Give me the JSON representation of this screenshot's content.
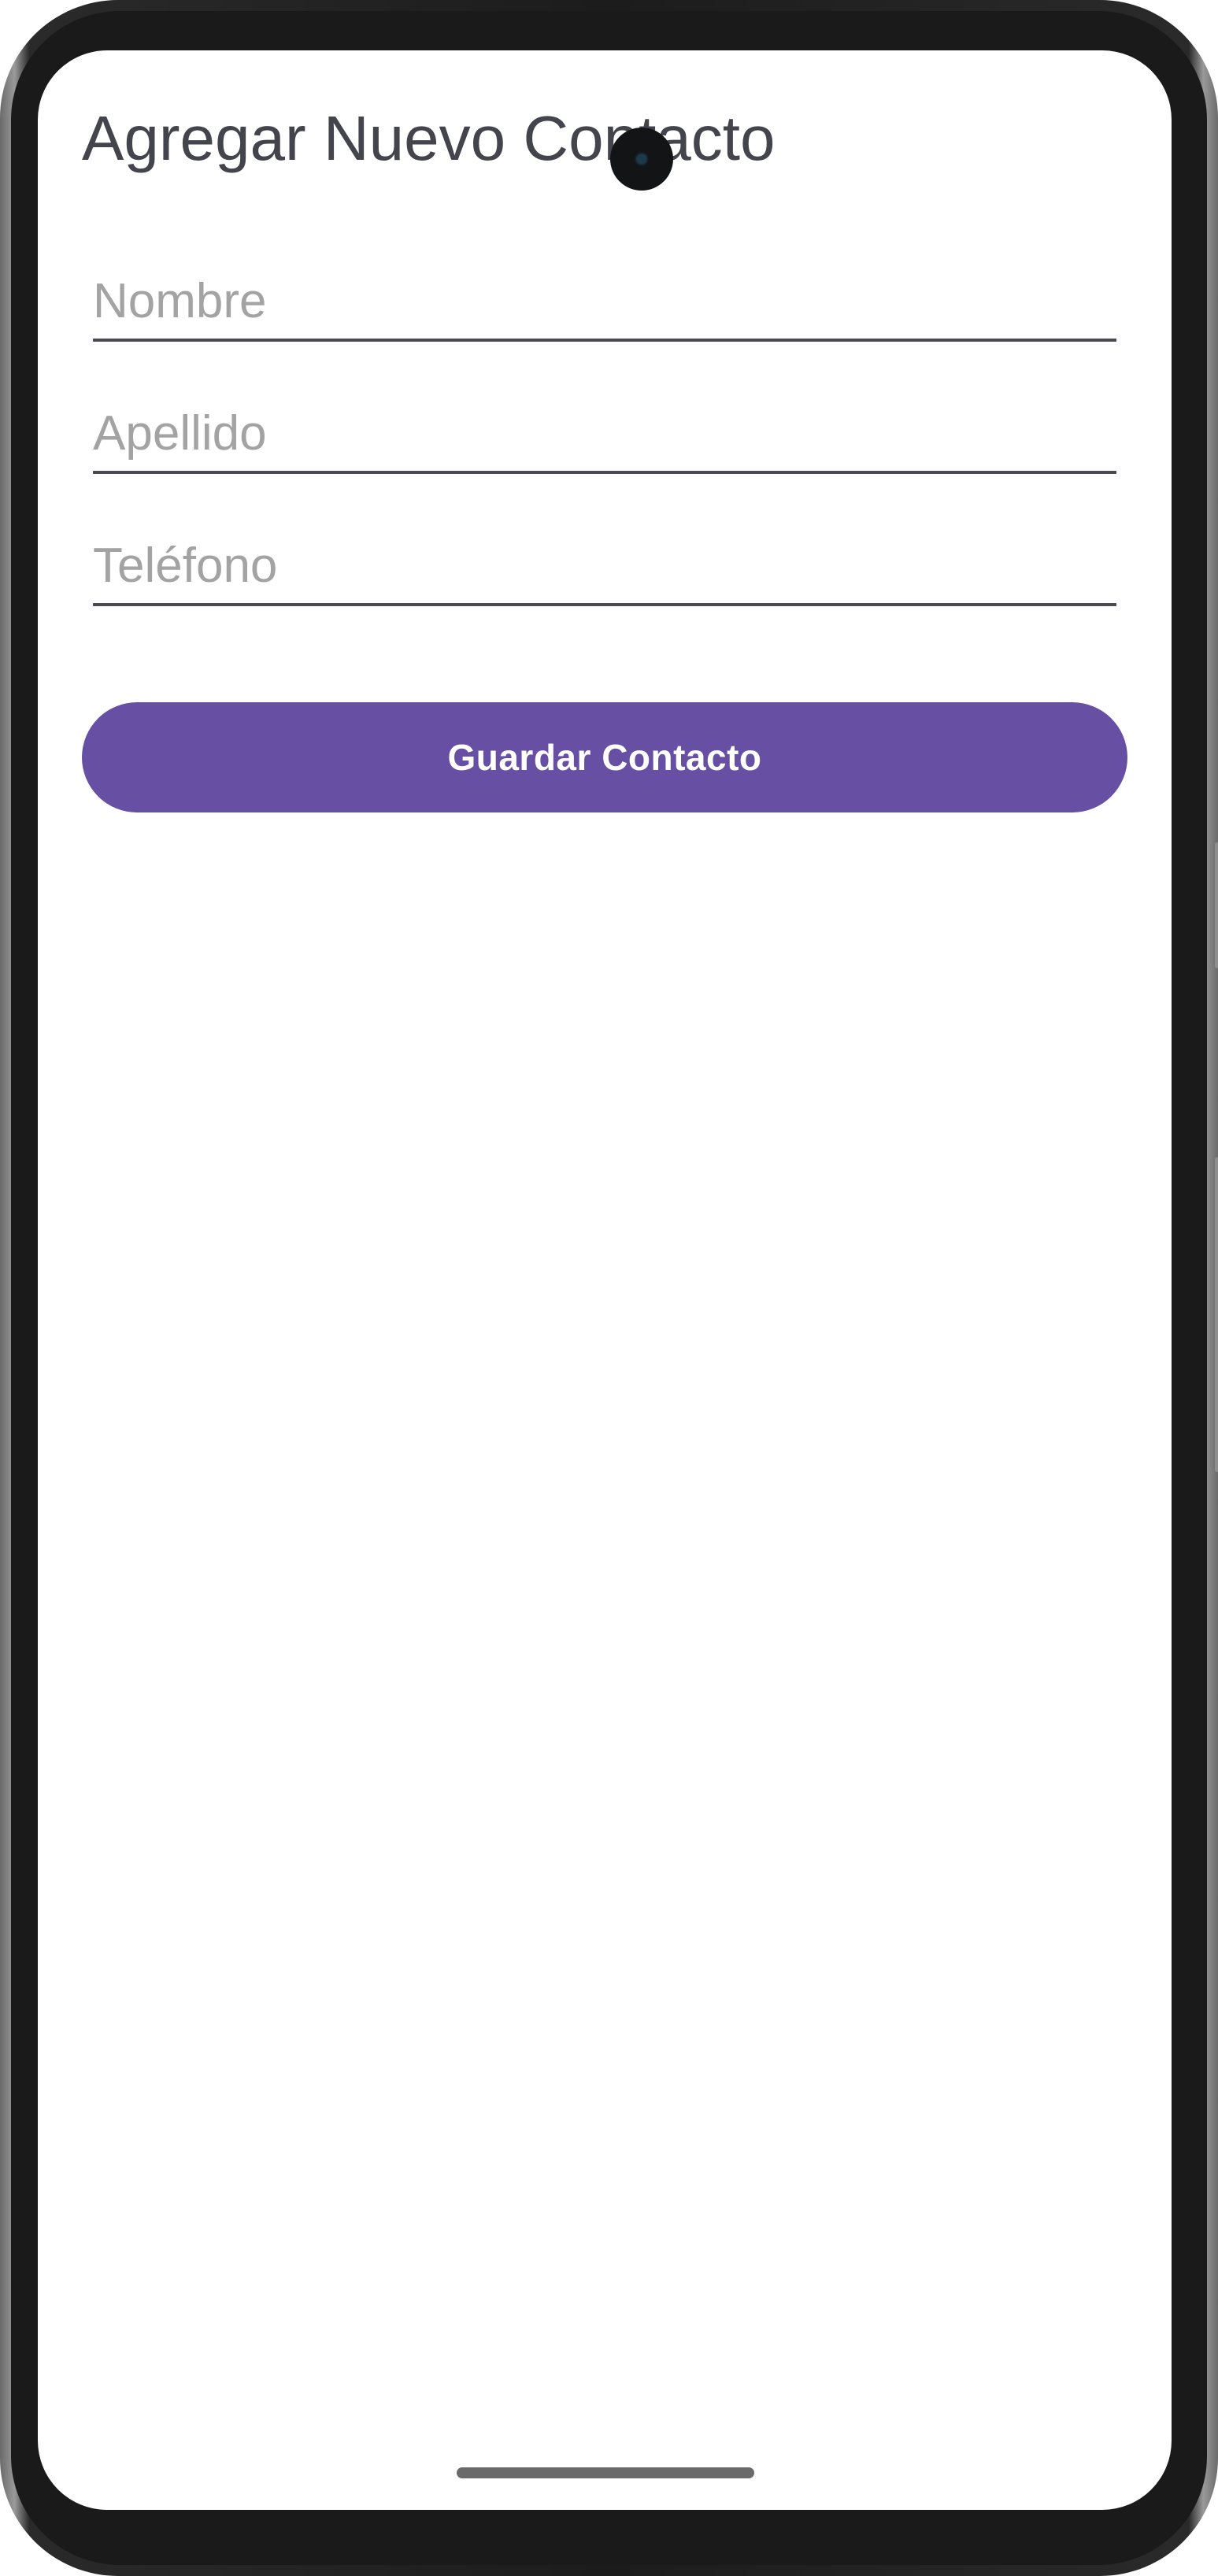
{
  "screen": {
    "title": "Agregar Nuevo Contacto",
    "form": {
      "first_name": {
        "placeholder": "Nombre",
        "value": ""
      },
      "last_name": {
        "placeholder": "Apellido",
        "value": ""
      },
      "phone": {
        "placeholder": "Teléfono",
        "value": ""
      }
    },
    "save_button_label": "Guardar Contacto"
  },
  "colors": {
    "accent": "#6750a4",
    "title_text": "#44444c",
    "placeholder_text": "#a3a3a3",
    "field_underline": "#4a4a55",
    "background": "#ffffff"
  },
  "icons": {
    "camera": "front-camera-icon",
    "home_indicator": "gesture-bar-icon"
  }
}
